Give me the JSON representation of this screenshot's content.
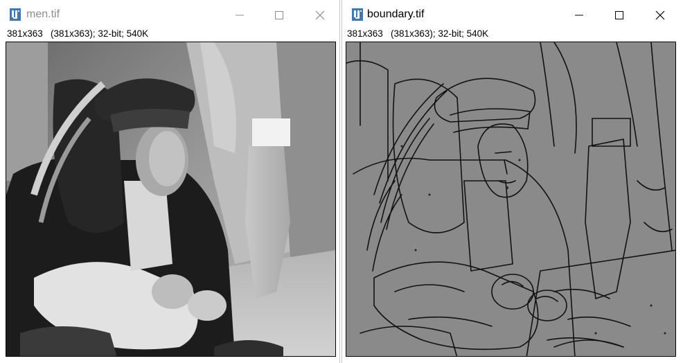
{
  "windows": [
    {
      "title": "men.tif",
      "info": "381x363   (381x363); 32-bit; 540K",
      "active": false
    },
    {
      "title": "boundary.tif",
      "info": "381x363   (381x363); 32-bit; 540K",
      "active": true
    }
  ],
  "icons": {
    "app": "imagej-icon",
    "minimize": "minimize-icon",
    "maximize": "maximize-icon",
    "close": "close-icon"
  },
  "colors": {
    "inactive_title": "#8c8c8c",
    "active_title": "#000000",
    "app_icon_blue": "#3c78b4",
    "edge_background": "#8a8a8a"
  }
}
